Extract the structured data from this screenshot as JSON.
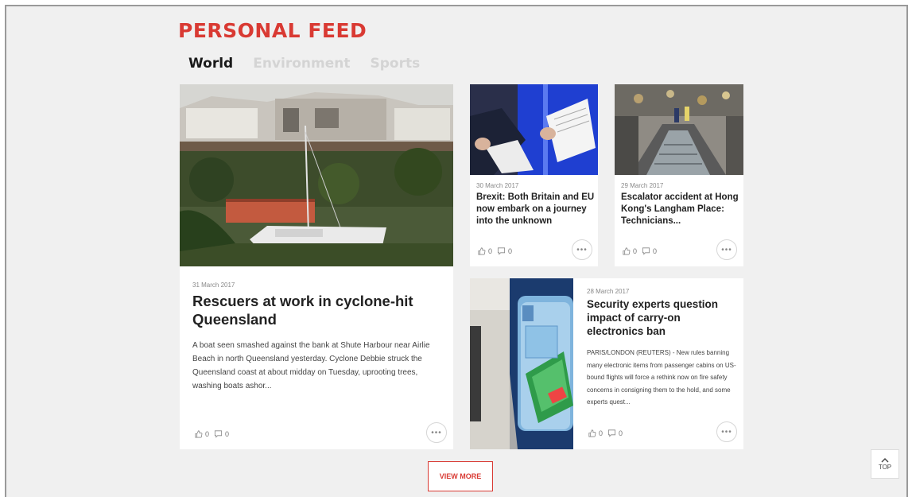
{
  "header": {
    "title": "PERSONAL FEED"
  },
  "tabs": [
    "World",
    "Environment",
    "Sports"
  ],
  "articles": [
    {
      "date": "31 March 2017",
      "headline": "Rescuers at work in cyclone-hit Queensland",
      "excerpt": "A boat seen smashed against the bank at Shute Harbour near Airlie Beach in north Queensland yesterday. Cyclone Debbie struck the Queensland coast at about midday on Tuesday, uprooting trees, washing boats ashor...",
      "likes": "0",
      "comments": "0"
    },
    {
      "date": "30 March 2017",
      "headline": "Brexit: Both Britain and EU now embark on a journey into the unknown",
      "likes": "0",
      "comments": "0"
    },
    {
      "date": "29 March 2017",
      "headline": "Escalator accident at Hong Kong's Langham Place: Technicians...",
      "likes": "0",
      "comments": "0"
    },
    {
      "date": "28 March 2017",
      "headline": "Security experts question impact of carry-on electronics ban",
      "excerpt": "PARIS/LONDON (REUTERS) - New rules banning many electronic items from passenger cabins on US-bound flights will force a rethink now on fire safety concerns in consigning them to the hold, and some experts quest...",
      "likes": "0",
      "comments": "0"
    }
  ],
  "view_more_label": "VIEW MORE",
  "top_label": "TOP",
  "icons": {
    "like": "thumbs-up-icon",
    "comment": "speech-bubble-icon",
    "more": "ellipsis-icon"
  }
}
